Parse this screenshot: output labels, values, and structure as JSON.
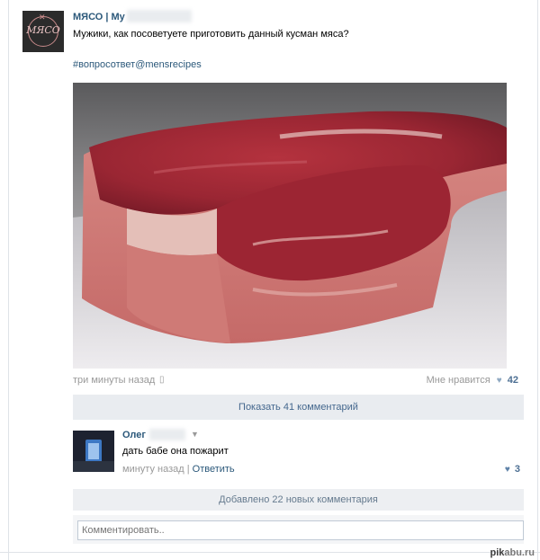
{
  "post": {
    "group_name": "МЯСО | Му",
    "avatar_text": "МЯСО",
    "text": "Мужики, как посоветуете приготовить данный кусман мяса?",
    "hashtag": "#вопросответ@mensrecipes",
    "timestamp": "три минуты назад",
    "likes_label": "Мне нравится",
    "likes_count": "42"
  },
  "comments": {
    "show_label": "Показать 41 комментарий",
    "items": [
      {
        "author": "Олег",
        "text": "дать бабе она пожарит",
        "time": "минуту назад",
        "separator": "|",
        "reply_label": "Ответить",
        "likes": "3"
      }
    ],
    "added_label": "Добавлено 22 новых комментария",
    "compose_placeholder": "Комментировать.."
  },
  "watermark": {
    "prefix": "pik",
    "suffix": "abu.ru"
  },
  "icons": {
    "like": "heart-icon",
    "mobile": "phone-icon",
    "menu": "caret-down-icon"
  },
  "colors": {
    "link": "#2b587a",
    "bar": "#e9ecf0",
    "meta": "#999999"
  }
}
